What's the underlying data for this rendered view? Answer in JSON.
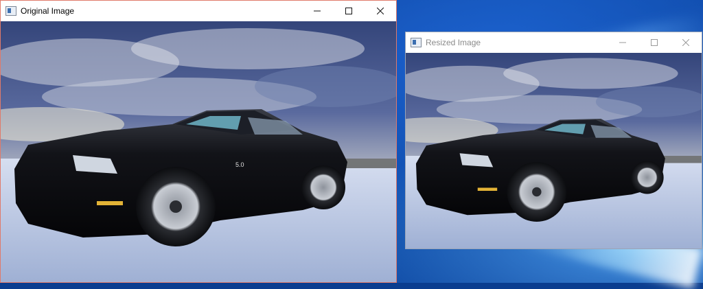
{
  "windows": {
    "original": {
      "title": "Original Image",
      "icon": "window-app-icon"
    },
    "resized": {
      "title": "Resized Image",
      "icon": "window-app-icon"
    }
  },
  "controls": {
    "minimize_glyph": "—",
    "maximize_glyph": "☐",
    "close_glyph": "✕"
  },
  "badge": "5.0",
  "colors": {
    "sky_top": "#3a4f86",
    "cloud": "#c9cfdd",
    "horizon": "#f2ead0",
    "snow": "#c9d6ee",
    "car": "#0b0c10",
    "active_border": "#e07a6a"
  }
}
